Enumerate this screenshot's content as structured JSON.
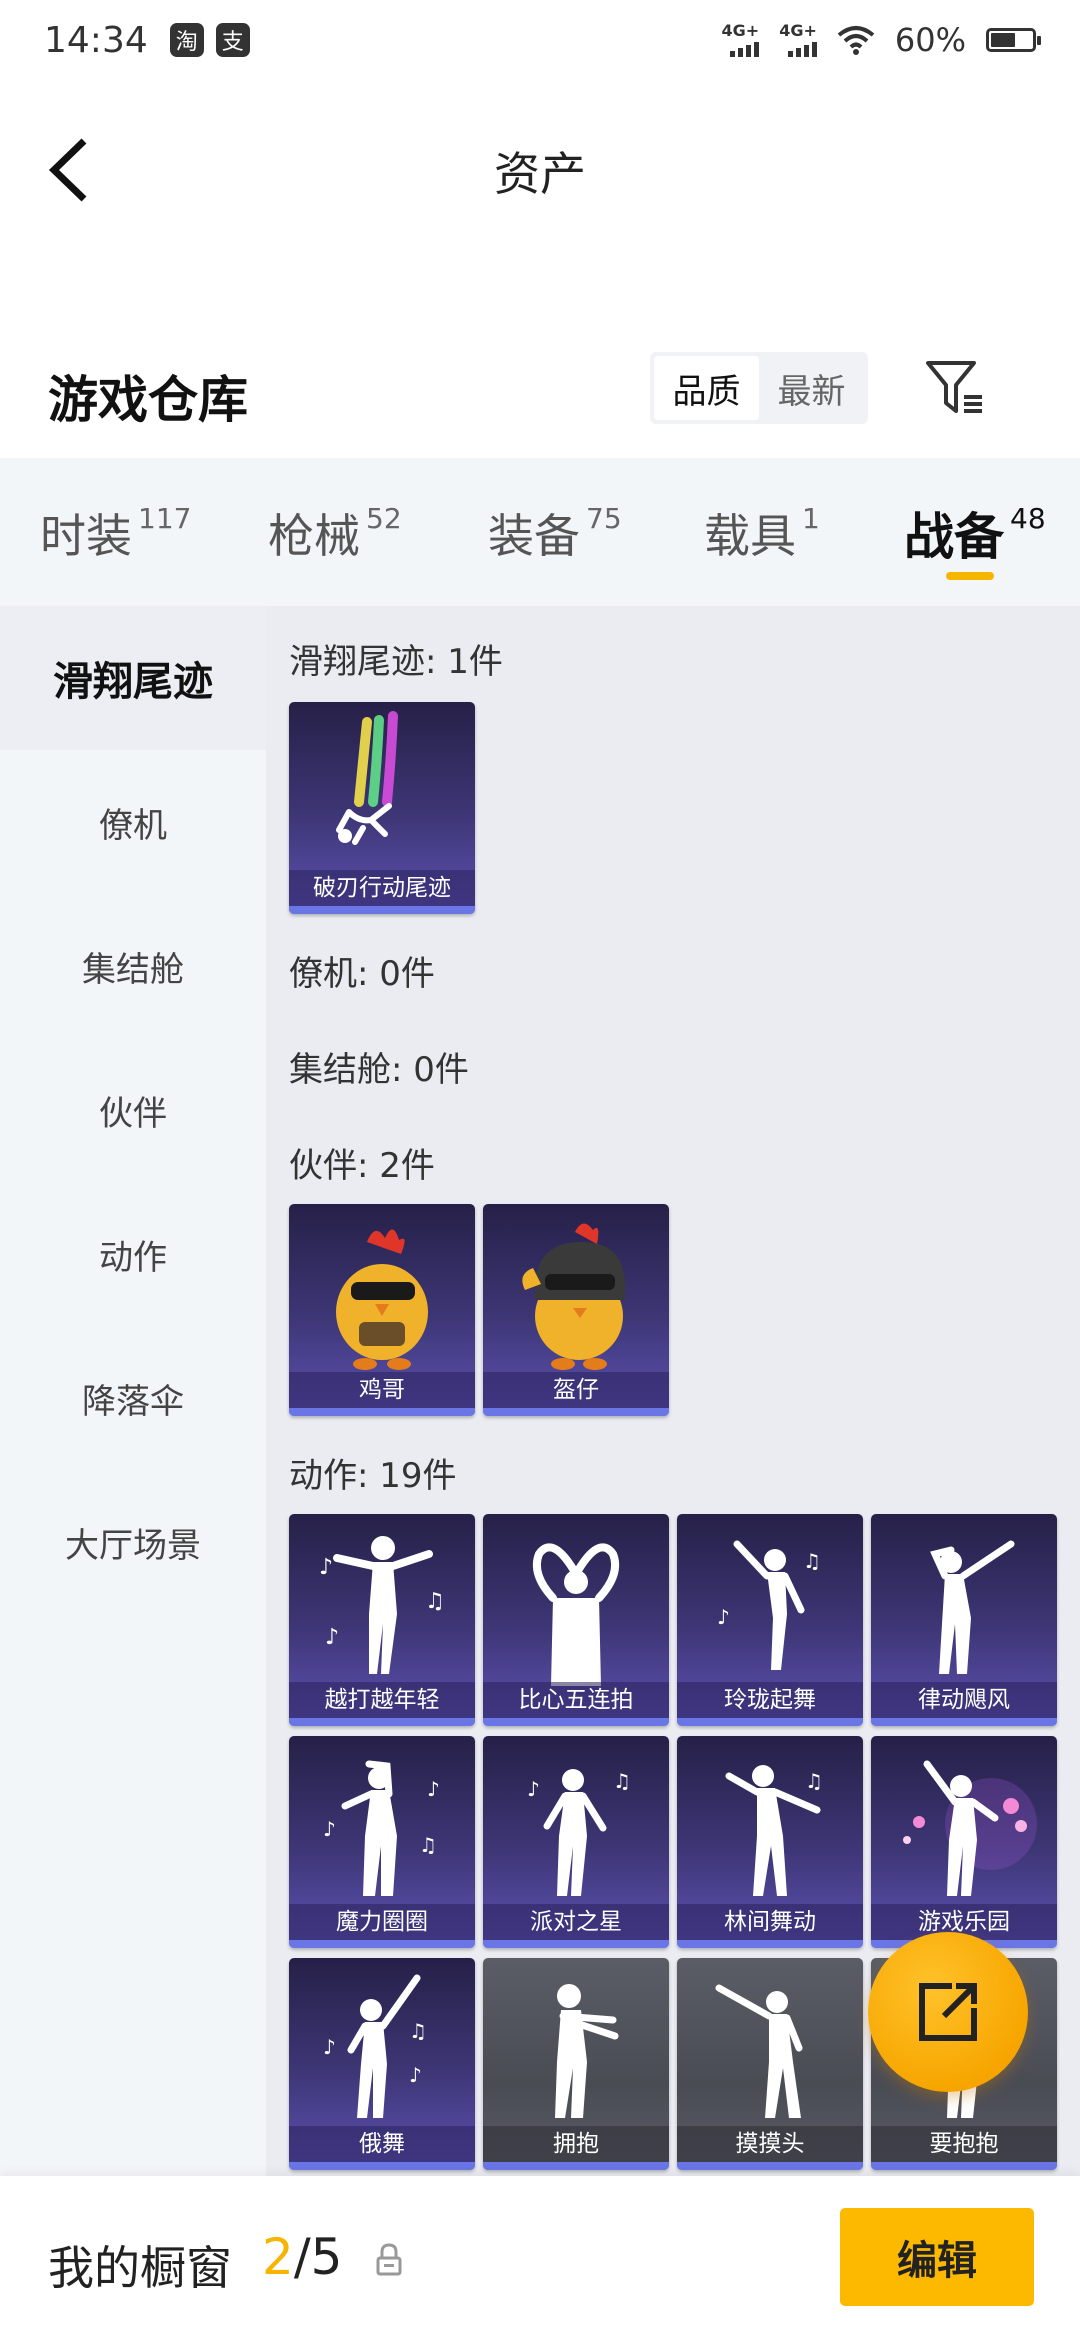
{
  "status_bar": {
    "time": "14:34",
    "app_icon_1": "淘",
    "app_icon_2": "支",
    "signal_1": "4G+",
    "signal_2": "4G+",
    "battery": "60%",
    "icons": [
      "taobao-icon",
      "alipay-icon",
      "signal-icon",
      "wifi-icon",
      "battery-icon"
    ]
  },
  "header": {
    "title": "资产",
    "back_icon": "chevron-left-icon"
  },
  "warehouse": {
    "title": "游戏仓库",
    "sort_options": [
      "品质",
      "最新"
    ],
    "active_sort": "品质",
    "filter_icon": "filter-icon"
  },
  "tabs": [
    {
      "label": "时装",
      "count": "117"
    },
    {
      "label": "枪械",
      "count": "52"
    },
    {
      "label": "装备",
      "count": "75"
    },
    {
      "label": "载具",
      "count": "1"
    },
    {
      "label": "战备",
      "count": "48"
    }
  ],
  "active_tab": "战备",
  "sidebar": {
    "items": [
      "滑翔尾迹",
      "僚机",
      "集结舱",
      "伙伴",
      "动作",
      "降落伞",
      "大厅场景"
    ],
    "active": "滑翔尾迹"
  },
  "sections": [
    {
      "title": "滑翔尾迹: 1件",
      "items": [
        "破刃行动尾迹"
      ]
    },
    {
      "title": "僚机: 0件",
      "items": []
    },
    {
      "title": "集结舱: 0件",
      "items": []
    },
    {
      "title": "伙伴: 2件",
      "items": [
        "鸡哥",
        "盔仔"
      ]
    },
    {
      "title": "动作: 19件",
      "items": [
        "越打越年轻",
        "比心五连拍",
        "玲珑起舞",
        "律动飓风",
        "魔力圈圈",
        "派对之星",
        "林间舞动",
        "游戏乐园",
        "俄舞",
        "拥抱",
        "摸摸头",
        "要抱抱"
      ]
    }
  ],
  "float_button": {
    "icon": "share-icon"
  },
  "bottom_bar": {
    "label": "我的橱窗",
    "current": "2",
    "separator": "/",
    "total": "5",
    "lock_icon": "lock-icon",
    "edit_label": "编辑"
  },
  "colors": {
    "accent": "#f5b500",
    "card_purple": "#3e3777",
    "card_grey": "#4a4c54"
  }
}
